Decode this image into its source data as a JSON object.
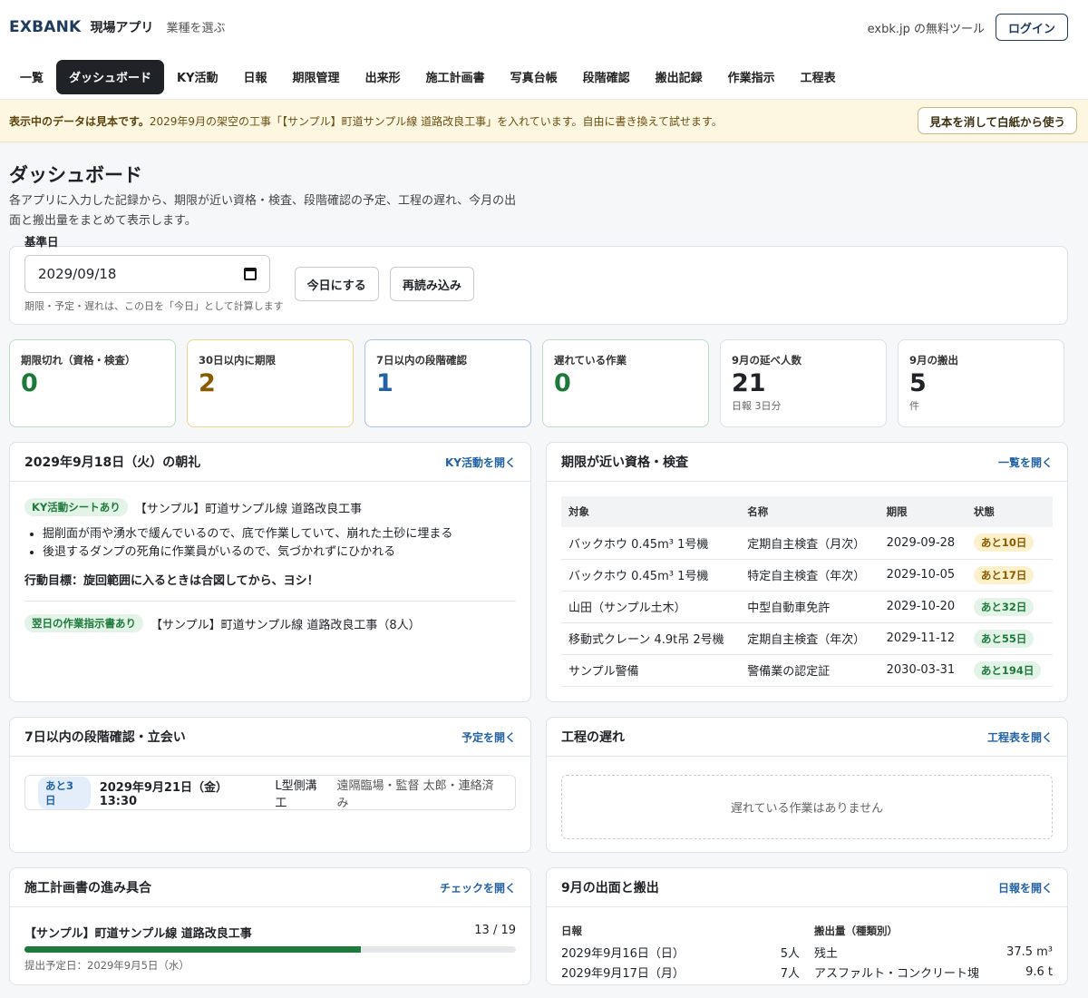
{
  "header": {
    "logo": "EXBANK",
    "app_name": "現場アプリ",
    "industry_link": "業種を選ぶ",
    "free_tool": "exbk.jp の無料ツール",
    "login": "ログイン"
  },
  "nav": [
    {
      "label": "一覧",
      "active": false
    },
    {
      "label": "ダッシュボード",
      "active": true
    },
    {
      "label": "KY活動",
      "active": false
    },
    {
      "label": "日報",
      "active": false
    },
    {
      "label": "期限管理",
      "active": false
    },
    {
      "label": "出来形",
      "active": false
    },
    {
      "label": "施工計画書",
      "active": false
    },
    {
      "label": "写真台帳",
      "active": false
    },
    {
      "label": "段階確認",
      "active": false
    },
    {
      "label": "搬出記録",
      "active": false
    },
    {
      "label": "作業指示",
      "active": false
    },
    {
      "label": "工程表",
      "active": false
    }
  ],
  "notice": {
    "bold": "表示中のデータは見本です。",
    "text": "2029年9月の架空の工事「【サンプル】町道サンプル線 道路改良工事」を入れています。自由に書き換えて試せます。",
    "button": "見本を消して白紙から使う"
  },
  "page": {
    "title": "ダッシュボード",
    "desc": "各アプリに入力した記録から、期限が近い資格・検査、段階確認の予定、工程の遅れ、今月の出面と搬出量をまとめて表示します。"
  },
  "date_card": {
    "label": "基準日",
    "value": "2029/09/18",
    "hint": "期限・予定・遅れは、この日を「今日」として計算します",
    "today_btn": "今日にする",
    "reload_btn": "再読み込み"
  },
  "stats": [
    {
      "label": "期限切れ（資格・検査）",
      "value": "0",
      "sub": "",
      "color": "green"
    },
    {
      "label": "30日以内に期限",
      "value": "2",
      "sub": "",
      "color": "brown"
    },
    {
      "label": "7日以内の段階確認",
      "value": "1",
      "sub": "",
      "color": "blue"
    },
    {
      "label": "遅れている作業",
      "value": "0",
      "sub": "",
      "color": "green"
    },
    {
      "label": "9月の延べ人数",
      "value": "21",
      "sub": "日報 3日分",
      "color": "dark"
    },
    {
      "label": "9月の搬出",
      "value": "5",
      "sub": "件",
      "color": "dark"
    }
  ],
  "morning": {
    "title": "2029年9月18日（火）の朝礼",
    "link": "KY活動を開く",
    "ky_tag": "KY活動シートあり",
    "ky_project": "【サンプル】町道サンプル線 道路改良工事",
    "bullets": [
      "掘削面が雨や湧水で緩んでいるので、底で作業していて、崩れた土砂に埋まる",
      "後退するダンプの死角に作業員がいるので、気づかれずにひかれる"
    ],
    "goal": "行動目標：旋回範囲に入るときは合図してから、ヨシ！",
    "next_tag": "翌日の作業指示書あり",
    "next_project": "【サンプル】町道サンプル線 道路改良工事（8人）"
  },
  "deadlines": {
    "title": "期限が近い資格・検査",
    "link": "一覧を開く",
    "columns": [
      "対象",
      "名称",
      "期限",
      "状態"
    ],
    "rows": [
      {
        "target": "バックホウ 0.45m³ 1号機",
        "name": "定期自主検査（月次）",
        "due": "2029-09-28",
        "status": "あと10日",
        "tone": "yellow"
      },
      {
        "target": "バックホウ 0.45m³ 1号機",
        "name": "特定自主検査（年次）",
        "due": "2029-10-05",
        "status": "あと17日",
        "tone": "yellow"
      },
      {
        "target": "山田（サンプル土木）",
        "name": "中型自動車免許",
        "due": "2029-10-20",
        "status": "あと32日",
        "tone": "green"
      },
      {
        "target": "移動式クレーン 4.9t吊 2号機",
        "name": "定期自主検査（年次）",
        "due": "2029-11-12",
        "status": "あと55日",
        "tone": "green"
      },
      {
        "target": "サンプル警備",
        "name": "警備業の認定証",
        "due": "2030-03-31",
        "status": "あと194日",
        "tone": "green"
      }
    ]
  },
  "stage": {
    "title": "7日以内の段階確認・立会い",
    "link": "予定を開く",
    "tag": "あと3日",
    "when": "2029年9月21日（金） 13:30",
    "what": "L型側溝工",
    "note": "遠隔臨場・監督 太郎・連絡済み"
  },
  "delay": {
    "title": "工程の遅れ",
    "link": "工程表を開く",
    "empty": "遅れている作業はありません"
  },
  "plan": {
    "title": "施工計画書の進み具合",
    "link": "チェックを開く",
    "project": "【サンプル】町道サンプル線 道路改良工事",
    "count": "13 / 19",
    "progress": 0.684,
    "sub": "提出予定日：2029年9月5日（水）"
  },
  "output": {
    "title": "9月の出面と搬出",
    "link": "日報を開く",
    "daily_header": "日報",
    "daily": [
      {
        "date": "2029年9月16日（日）",
        "people": "5人"
      },
      {
        "date": "2029年9月17日（月）",
        "people": "7人"
      }
    ],
    "haul_header": "搬出量（種類別）",
    "haul": [
      {
        "kind": "残土",
        "amount": "37.5 m³"
      },
      {
        "kind": "アスファルト・コンクリート塊",
        "amount": "9.6 t"
      }
    ]
  }
}
